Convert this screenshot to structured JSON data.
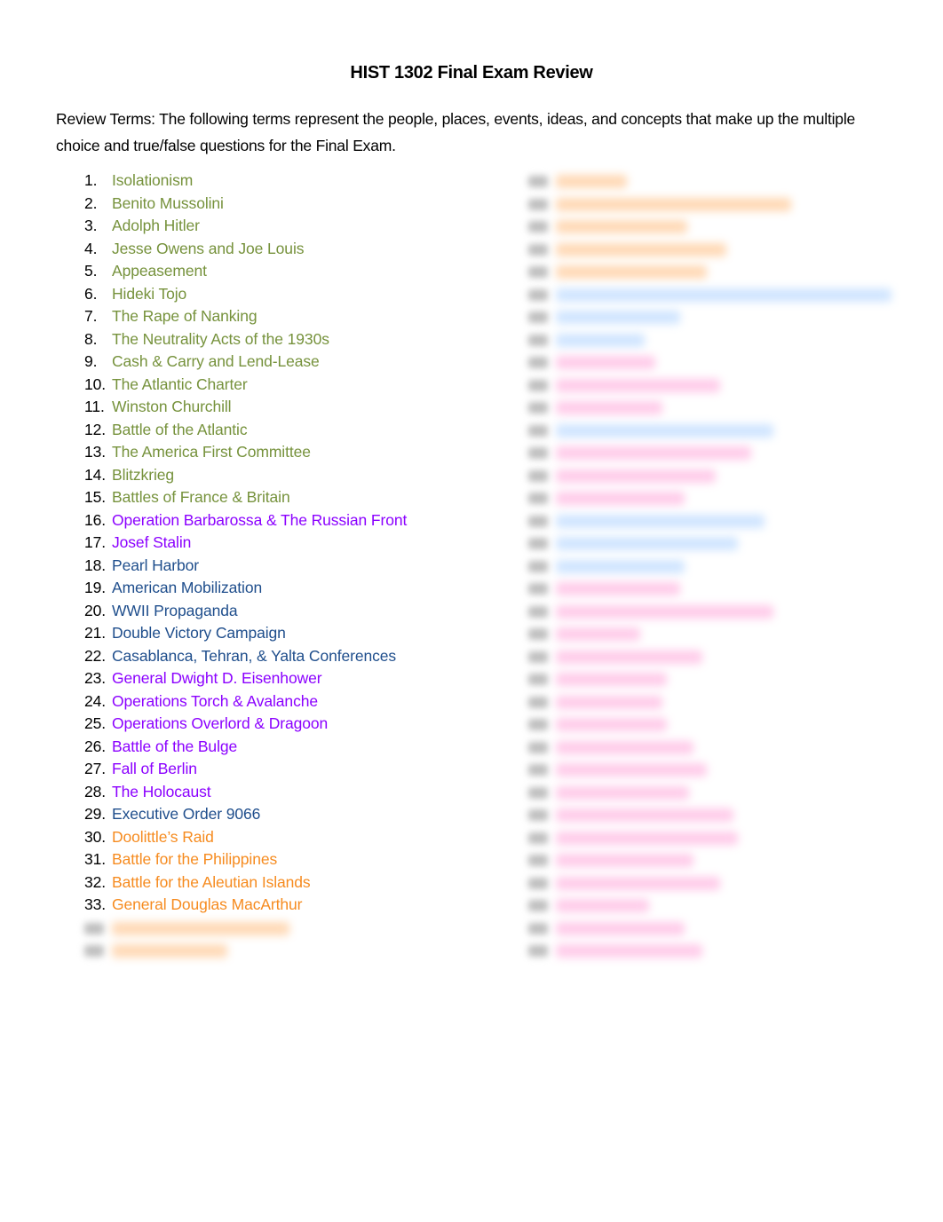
{
  "document": {
    "title": "HIST 1302 Final Exam Review",
    "intro": "Review Terms:  The following terms represent the people, places, events, ideas, and concepts that make up the multiple choice and true/false questions for the Final Exam."
  },
  "colors": {
    "green": "#76923c",
    "purple": "#8b00ff",
    "blue": "#1f4e8c",
    "orange": "#f68b1f",
    "blurred_orange": "#ffd2a8",
    "blurred_blue": "#c7e0ff",
    "blurred_pink": "#ffc2e6"
  },
  "terms_visible": [
    {
      "num": "1.",
      "label": "Isolationism",
      "color": "green"
    },
    {
      "num": "2.",
      "label": "Benito Mussolini",
      "color": "green"
    },
    {
      "num": "3.",
      "label": "Adolph Hitler",
      "color": "green"
    },
    {
      "num": "4.",
      "label": "Jesse Owens and Joe Louis",
      "color": "green"
    },
    {
      "num": "5.",
      "label": "Appeasement",
      "color": "green"
    },
    {
      "num": "6.",
      "label": "Hideki Tojo",
      "color": "green"
    },
    {
      "num": "7.",
      "label": "The Rape of Nanking",
      "color": "green"
    },
    {
      "num": "8.",
      "label": "The Neutrality Acts of the 1930s",
      "color": "green"
    },
    {
      "num": "9.",
      "label": "Cash & Carry and Lend-Lease",
      "color": "green"
    },
    {
      "num": "10.",
      "label": "The Atlantic Charter",
      "color": "green"
    },
    {
      "num": "11.",
      "label": "Winston Churchill",
      "color": "green"
    },
    {
      "num": "12.",
      "label": "Battle of the Atlantic",
      "color": "green"
    },
    {
      "num": "13.",
      "label": "The America First Committee",
      "color": "green"
    },
    {
      "num": "14.",
      "label": "Blitzkrieg",
      "color": "green"
    },
    {
      "num": "15.",
      "label": "Battles of France & Britain",
      "color": "green"
    },
    {
      "num": "16.",
      "label": "Operation Barbarossa & The Russian Front",
      "color": "purple"
    },
    {
      "num": "17.",
      "label": "Josef Stalin",
      "color": "purple"
    },
    {
      "num": "18.",
      "label": "Pearl Harbor",
      "color": "blue"
    },
    {
      "num": "19.",
      "label": "American Mobilization",
      "color": "blue"
    },
    {
      "num": "20.",
      "label": "WWII Propaganda",
      "color": "blue"
    },
    {
      "num": "21.",
      "label": "Double Victory Campaign",
      "color": "blue"
    },
    {
      "num": "22.",
      "label": "Casablanca, Tehran, & Yalta Conferences",
      "color": "blue"
    },
    {
      "num": "23.",
      "label": "General Dwight D. Eisenhower",
      "color": "purple"
    },
    {
      "num": "24.",
      "label": "Operations Torch & Avalanche",
      "color": "purple"
    },
    {
      "num": "25.",
      "label": "Operations Overlord & Dragoon",
      "color": "purple"
    },
    {
      "num": "26.",
      "label": "Battle of the Bulge",
      "color": "purple"
    },
    {
      "num": "27.",
      "label": "Fall of Berlin",
      "color": "purple"
    },
    {
      "num": "28.",
      "label": "The Holocaust",
      "color": "purple"
    },
    {
      "num": "29.",
      "label": "Executive Order 9066",
      "color": "blue"
    },
    {
      "num": "30.",
      "label": "Doolittle’s Raid",
      "color": "orange"
    },
    {
      "num": "31.",
      "label": "Battle for the Philippines",
      "color": "orange"
    },
    {
      "num": "32.",
      "label": "Battle for the Aleutian Islands",
      "color": "orange"
    },
    {
      "num": "33.",
      "label": "General Douglas MacArthur",
      "color": "orange"
    }
  ],
  "terms_blurred_left": [
    {
      "color": "orange"
    },
    {
      "color": "orange"
    }
  ],
  "terms_blurred_right": [
    {
      "color": "orange"
    },
    {
      "color": "orange"
    },
    {
      "color": "orange"
    },
    {
      "color": "orange"
    },
    {
      "color": "orange"
    },
    {
      "color": "blue"
    },
    {
      "color": "blue"
    },
    {
      "color": "blue"
    },
    {
      "color": "pink"
    },
    {
      "color": "pink"
    },
    {
      "color": "pink"
    },
    {
      "color": "blue"
    },
    {
      "color": "pink"
    },
    {
      "color": "pink"
    },
    {
      "color": "pink"
    },
    {
      "color": "blue"
    },
    {
      "color": "blue"
    },
    {
      "color": "blue"
    },
    {
      "color": "pink"
    },
    {
      "color": "pink"
    },
    {
      "color": "pink"
    },
    {
      "color": "pink"
    },
    {
      "color": "pink"
    },
    {
      "color": "pink"
    },
    {
      "color": "pink"
    },
    {
      "color": "pink"
    },
    {
      "color": "pink"
    },
    {
      "color": "pink"
    },
    {
      "color": "pink"
    },
    {
      "color": "pink"
    },
    {
      "color": "pink"
    },
    {
      "color": "pink"
    },
    {
      "color": "pink"
    },
    {
      "color": "pink"
    },
    {
      "color": "pink"
    }
  ]
}
